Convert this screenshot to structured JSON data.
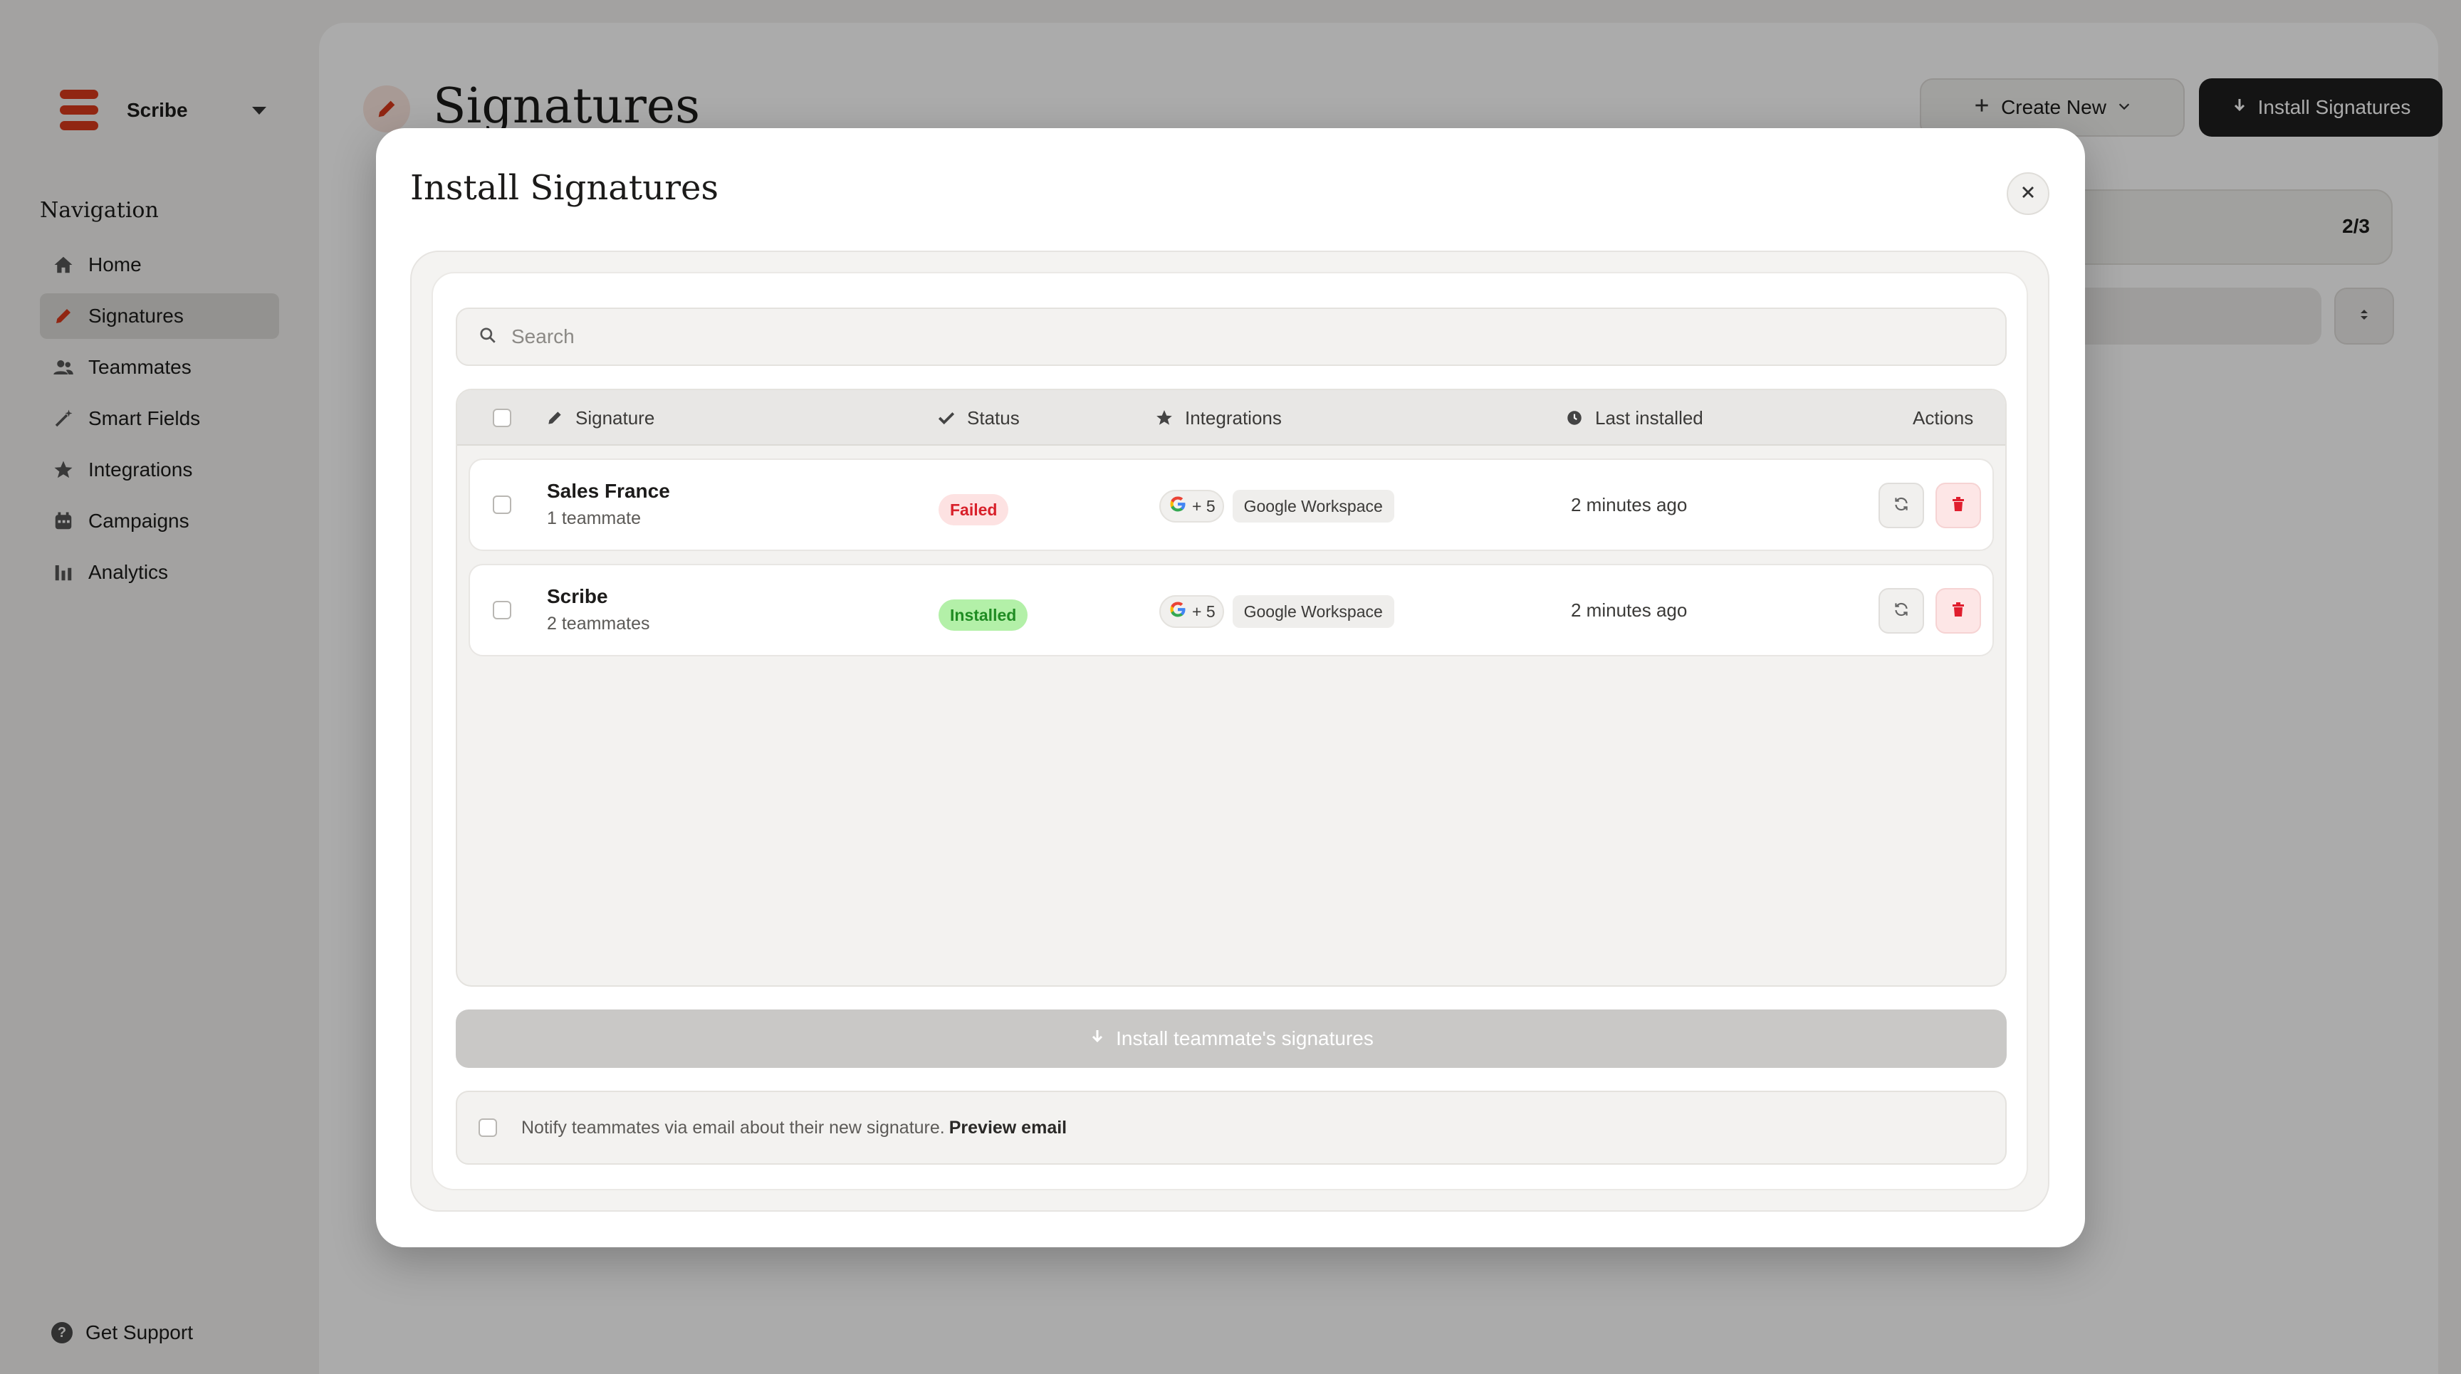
{
  "app": {
    "workspace_name": "Scribe",
    "nav_title": "Navigation",
    "nav_items": [
      {
        "label": "Home",
        "icon": "home-icon"
      },
      {
        "label": "Signatures",
        "icon": "pen-icon",
        "active": true
      },
      {
        "label": "Teammates",
        "icon": "users-icon"
      },
      {
        "label": "Smart Fields",
        "icon": "magic-wand-icon"
      },
      {
        "label": "Integrations",
        "icon": "star-icon"
      },
      {
        "label": "Campaigns",
        "icon": "calendar-icon"
      },
      {
        "label": "Analytics",
        "icon": "bar-chart-icon"
      }
    ],
    "support_label": "Get Support",
    "page_title": "Signatures",
    "create_new_label": "Create New",
    "install_signatures_label": "Install Signatures",
    "counter": "2/3",
    "accent_color": "#d93a1c"
  },
  "modal": {
    "title": "Install Signatures",
    "search": {
      "placeholder": "Search",
      "value": ""
    },
    "columns": {
      "signature": "Signature",
      "status": "Status",
      "integrations": "Integrations",
      "last_installed": "Last installed",
      "actions": "Actions"
    },
    "rows": [
      {
        "name": "Sales France",
        "teammates": "1 teammate",
        "status": "Failed",
        "integration_count": "+ 5",
        "integration_name": "Google Workspace",
        "last_installed": "2 minutes ago"
      },
      {
        "name": "Scribe",
        "teammates": "2 teammates",
        "status": "Installed",
        "integration_count": "+ 5",
        "integration_name": "Google Workspace",
        "last_installed": "2 minutes ago"
      }
    ],
    "install_button_label": "Install teammate's signatures",
    "notify_text": "Notify teammates via email about their new signature.",
    "preview_email_label": "Preview email"
  }
}
